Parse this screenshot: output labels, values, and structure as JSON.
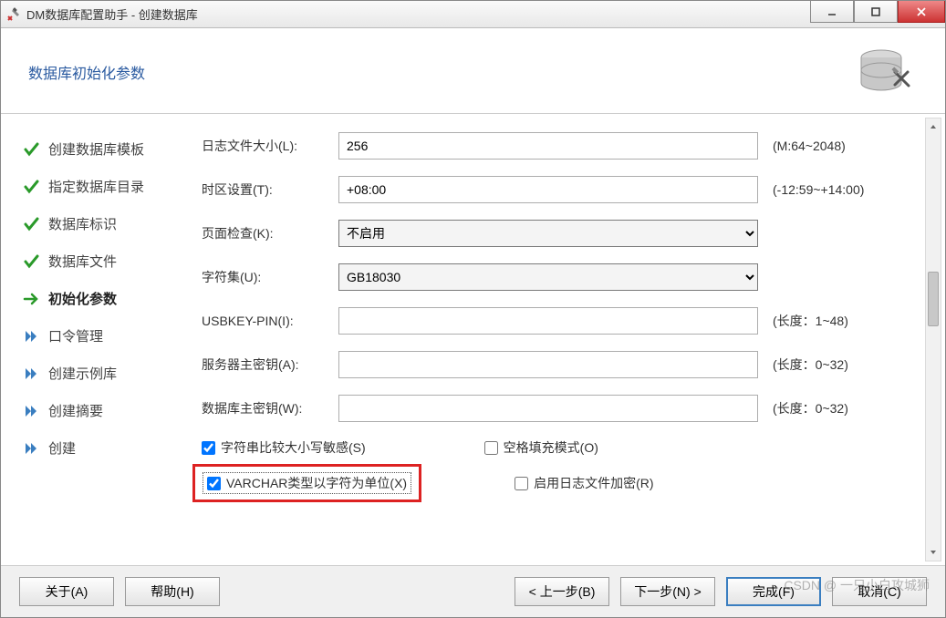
{
  "window": {
    "title": "DM数据库配置助手 - 创建数据库"
  },
  "header": {
    "title": "数据库初始化参数"
  },
  "nav": {
    "items": [
      {
        "label": "创建数据库模板",
        "icon": "check"
      },
      {
        "label": "指定数据库目录",
        "icon": "check"
      },
      {
        "label": "数据库标识",
        "icon": "check"
      },
      {
        "label": "数据库文件",
        "icon": "check"
      },
      {
        "label": "初始化参数",
        "icon": "arrow",
        "current": true
      },
      {
        "label": "口令管理",
        "icon": "forward"
      },
      {
        "label": "创建示例库",
        "icon": "forward"
      },
      {
        "label": "创建摘要",
        "icon": "forward"
      },
      {
        "label": "创建",
        "icon": "forward"
      }
    ]
  },
  "form": {
    "log_size": {
      "label": "日志文件大小(L):",
      "value": "256",
      "hint": "(M:64~2048)"
    },
    "tz": {
      "label": "时区设置(T):",
      "value": "+08:00",
      "hint": "(-12:59~+14:00)"
    },
    "pagechk": {
      "label": "页面检查(K):",
      "value": "不启用"
    },
    "charset": {
      "label": "字符集(U):",
      "value": "GB18030"
    },
    "usbkey": {
      "label": "USBKEY-PIN(I):",
      "value": "",
      "hint": "(长度：1~48)"
    },
    "srvkey": {
      "label": "服务器主密钥(A):",
      "value": "",
      "hint": "(长度：0~32)"
    },
    "dbkey": {
      "label": "数据库主密钥(W):",
      "value": "",
      "hint": "(长度：0~32)"
    }
  },
  "checks": {
    "case_sensitive": {
      "label": "字符串比较大小写敏感(S)",
      "checked": true
    },
    "blank_pad": {
      "label": "空格填充模式(O)",
      "checked": false
    },
    "varchar_char": {
      "label": "VARCHAR类型以字符为单位(X)",
      "checked": true
    },
    "log_encrypt": {
      "label": "启用日志文件加密(R)",
      "checked": false
    }
  },
  "footer": {
    "about": "关于(A)",
    "help": "帮助(H)",
    "prev": "< 上一步(B)",
    "next": "下一步(N) >",
    "finish": "完成(F)",
    "cancel": "取消(C)"
  },
  "watermark": "CSDN @ 一只小白攻城狮"
}
